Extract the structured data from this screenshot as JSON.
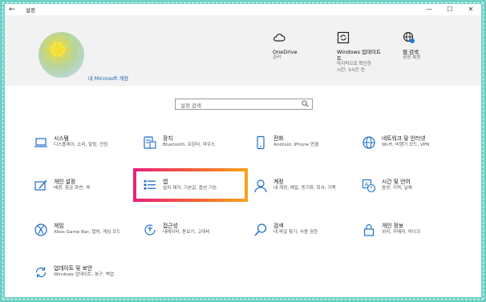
{
  "window": {
    "title": "설정",
    "back": "←",
    "minimize": "—",
    "maximize": "☐",
    "close": "✕"
  },
  "header": {
    "account_link": "내 Microsoft 계정",
    "items": [
      {
        "icon": "cloud-icon",
        "title": "OneDrive",
        "sub1": "관리",
        "sub2": ""
      },
      {
        "icon": "sync-icon",
        "title": "Windows 업데이트",
        "sub1": "마지막으로 확인한",
        "sub2": "시간: 3시간 전"
      },
      {
        "icon": "globe-icon",
        "title": "웹 검색",
        "sub1": "권장 복원",
        "sub2": ""
      }
    ],
    "windows_update_line2": "트"
  },
  "search": {
    "placeholder": "설정 검색",
    "icon": "magnifier-icon"
  },
  "tiles": [
    {
      "title": "시스템",
      "desc": "디스플레이, 소리, 알림, 전원",
      "icon": "laptop-icon"
    },
    {
      "title": "장치",
      "desc": "Bluetooth, 프린터, 마우스",
      "icon": "keyboard-icon"
    },
    {
      "title": "전화",
      "desc": "Android, iPhone 연결",
      "icon": "phone-icon"
    },
    {
      "title": "네트워크 및 인터넷",
      "desc": "Wi-Fi, 비행기 모드, VPN",
      "icon": "globe-icon"
    },
    {
      "title": "개인 설정",
      "desc": "배경, 잠금 화면, 색",
      "icon": "paint-icon"
    },
    {
      "title": "앱",
      "desc": "설치 제거, 기본값, 옵션 기능",
      "icon": "apps-list-icon"
    },
    {
      "title": "계정",
      "desc": "내 계정, 메일, 동기화, 회사, 가족",
      "icon": "person-icon"
    },
    {
      "title": "시간 및 언어",
      "desc": "음성, 지역, 날짜",
      "icon": "time-language-icon"
    },
    {
      "title": "게임",
      "desc": "Xbox Game Bar, 캡처, 게임 모드",
      "icon": "xbox-icon"
    },
    {
      "title": "접근성",
      "desc": "내레이터, 돋보기, 고대비",
      "icon": "accessibility-icon"
    },
    {
      "title": "검색",
      "desc": "내 파일 찾기, 사용 권한",
      "icon": "search-icon"
    },
    {
      "title": "개인 정보",
      "desc": "위치, 카메라, 마이크",
      "icon": "lock-icon"
    },
    {
      "title": "업데이트 및 보안",
      "desc": "Windows 업데이트, 복구, 백업",
      "icon": "update-icon"
    }
  ],
  "colors": {
    "accent": "#1a62b3",
    "frame": "#6fd0c6",
    "highlight_start": "#e6227b",
    "highlight_end": "#f6a21d",
    "badge": "#1e7be0"
  }
}
